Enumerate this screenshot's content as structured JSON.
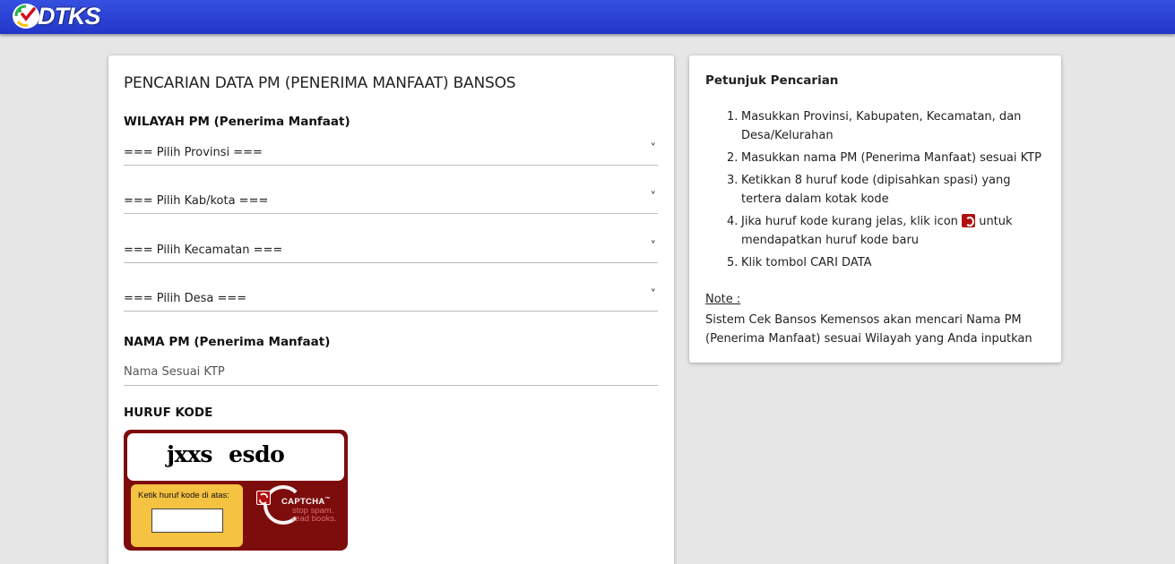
{
  "header": {
    "logo_text": "DTKS",
    "bar_color": "#2b44d6"
  },
  "form": {
    "title": "PENCARIAN DATA PM (PENERIMA MANFAAT) BANSOS",
    "wilayah_label": "WILAYAH PM (Penerima Manfaat)",
    "selects": [
      {
        "label": "=== Pilih Provinsi ==="
      },
      {
        "label": "=== Pilih Kab/kota ==="
      },
      {
        "label": "=== Pilih Kecamatan ==="
      },
      {
        "label": "=== Pilih Desa ==="
      }
    ],
    "chevron": "˅",
    "nama_label": "NAMA PM (Penerima Manfaat)",
    "nama_placeholder": "Nama Sesuai KTP",
    "nama_value": "",
    "kode_label": "HURUF KODE",
    "captcha": {
      "word": "jxxs esdo",
      "entry_label": "Ketik huruf kode di atas:",
      "entry_value": "",
      "brand": "CAPTCHA",
      "tm": "™",
      "tagline_1": "stop spam.",
      "tagline_2": "read books.",
      "bg_color": "#7d0c0c",
      "entry_color": "#f5c242"
    }
  },
  "help": {
    "title": "Petunjuk Pencarian",
    "steps": [
      {
        "num": "1.",
        "text": "Masukkan Provinsi, Kabupaten, Kecamatan, dan Desa/Kelurahan"
      },
      {
        "num": "2.",
        "text": "Masukkan nama PM (Penerima Manfaat) sesuai KTP"
      },
      {
        "num": "3.",
        "text": "Ketikkan 8 huruf kode (dipisahkan spasi) yang tertera dalam kotak kode"
      },
      {
        "num": "4.",
        "text_before": "Jika huruf kode kurang jelas, klik icon",
        "text_after": "untuk mendapatkan huruf kode baru"
      },
      {
        "num": "5.",
        "text": "Klik tombol CARI DATA"
      }
    ],
    "note_label": "Note :",
    "note_text": "Sistem Cek Bansos Kemensos akan mencari Nama PM (Penerima Manfaat) sesuai Wilayah yang Anda inputkan"
  }
}
